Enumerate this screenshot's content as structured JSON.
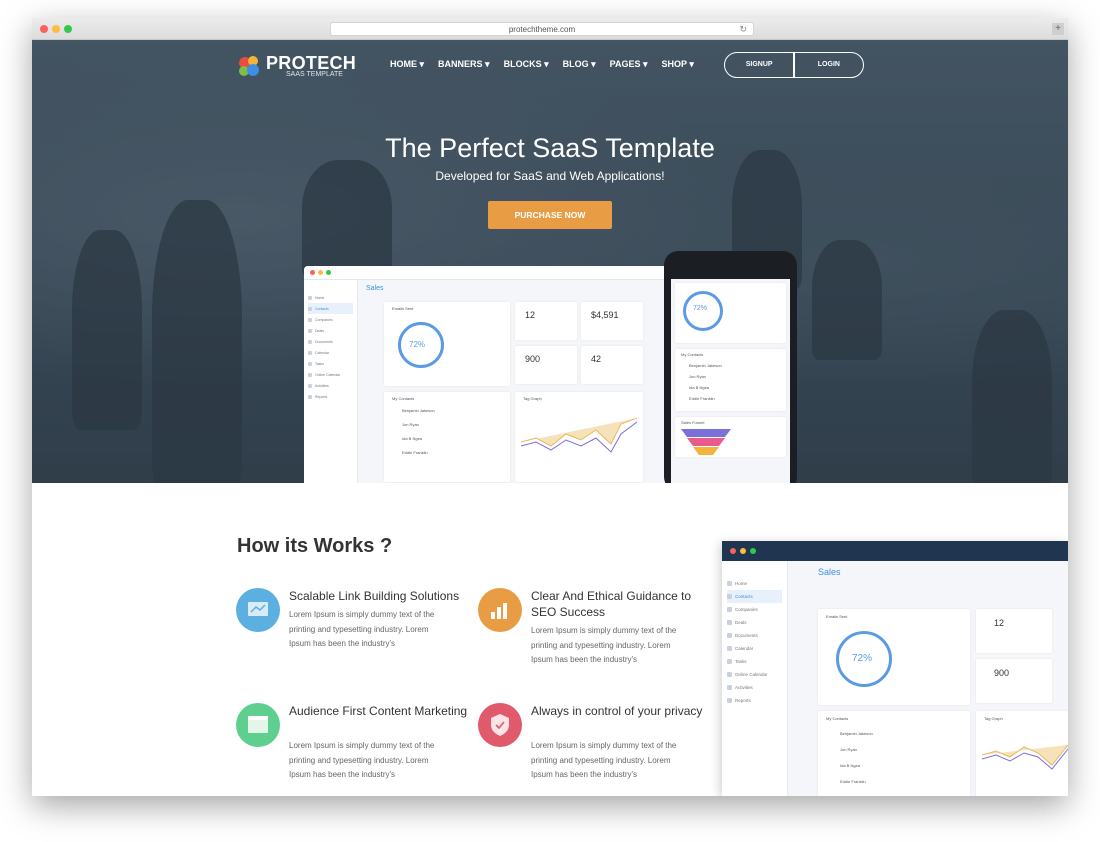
{
  "browser": {
    "url": "protechtheme.com"
  },
  "brand": {
    "name": "PROTECH",
    "tagline": "SAAS TEMPLATE"
  },
  "nav": {
    "items": [
      "HOME",
      "BANNERS",
      "BLOCKS",
      "BLOG",
      "PAGES",
      "SHOP"
    ],
    "signup": "SIGNUP",
    "login": "LOGIN"
  },
  "hero": {
    "title": "The Perfect SaaS Template",
    "subtitle": "Developed for SaaS and Web Applications!",
    "cta": "PURCHASE NOW"
  },
  "dashboard": {
    "page_title": "Sales",
    "sidebar": [
      "Home",
      "Contacts",
      "Companies",
      "Deals",
      "Documents",
      "Calendar",
      "Tasks",
      "Online Calendar",
      "Activities",
      "Reports"
    ],
    "emails_sent_label": "Emails Sent",
    "emails_percent": "72%",
    "stats": [
      {
        "value": "12"
      },
      {
        "value": "$4,591"
      },
      {
        "value": "900"
      },
      {
        "value": "42"
      }
    ],
    "contacts_label": "My Contacts",
    "contacts": [
      "Benjamin Jakeson",
      "Jon Ryan",
      "Ida B Ngea",
      "Eddie Franklin"
    ],
    "tag_graph_label": "Tag Graph"
  },
  "phone": {
    "emails_percent": "72%",
    "contacts_label": "My Contacts",
    "contacts": [
      "Benjamin Jakeson",
      "Jon Ryan",
      "Ida B Ngea",
      "Eddie Franklin"
    ],
    "funnel_label": "Sales Funnel"
  },
  "how": {
    "title": "How its Works ?",
    "features": [
      {
        "title": "Scalable Link Building Solutions",
        "icon": "monitor-chart-icon",
        "color": "#5cb0e0",
        "text": [
          "Lorem Ipsum is simply dummy text of the",
          "printing and typesetting industry. Lorem",
          "Ipsum has been the industry's"
        ]
      },
      {
        "title": "Clear And Ethical Guidance to SEO Success",
        "icon": "bar-chart-icon",
        "color": "#e89d45",
        "text": [
          "Lorem Ipsum is simply dummy text of the",
          "printing and typesetting industry. Lorem",
          "Ipsum has been the industry's"
        ]
      },
      {
        "title": "Audience First Content Marketing",
        "icon": "browser-window-icon",
        "color": "#5fcf8f",
        "text": [
          "Lorem Ipsum is simply dummy text of the",
          "printing and typesetting industry. Lorem",
          "Ipsum has been the industry's"
        ]
      },
      {
        "title": "Always in control of your privacy",
        "icon": "shield-check-icon",
        "color": "#e05a6b",
        "text": [
          "Lorem Ipsum is simply dummy text of the",
          "printing and typesetting industry. Lorem",
          "Ipsum has been the industry's"
        ]
      }
    ]
  },
  "dashboard2": {
    "page_title": "Sales",
    "sidebar": [
      "Home",
      "Contacts",
      "Companies",
      "Deals",
      "Documents",
      "Calendar",
      "Tasks",
      "Online Calendar",
      "Activities",
      "Reports"
    ],
    "emails_sent_label": "Emails Sent",
    "emails_percent": "72%",
    "stat1": "12",
    "stat2": "900",
    "contacts_label": "My Contacts",
    "contacts": [
      "Benjamin Jakeson",
      "Jon Ryan",
      "Ida B Ngea",
      "Eddie Franklin"
    ],
    "tag_graph_label": "Tag Graph"
  }
}
